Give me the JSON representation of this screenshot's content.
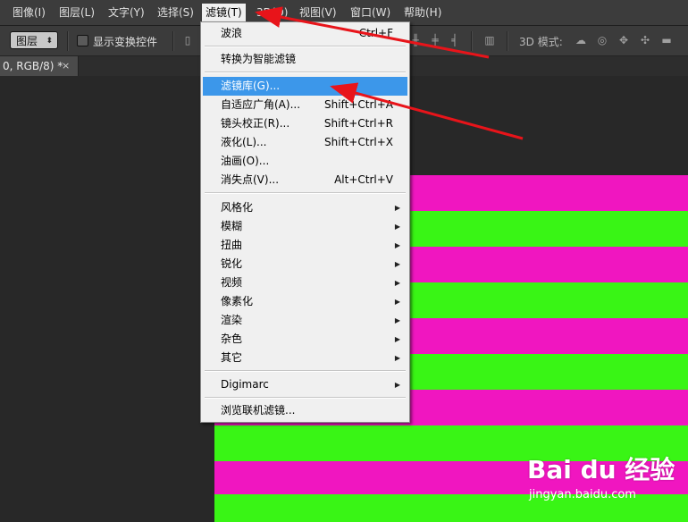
{
  "menubar": {
    "items": [
      {
        "label": "图像(I)"
      },
      {
        "label": "图层(L)"
      },
      {
        "label": "文字(Y)"
      },
      {
        "label": "选择(S)"
      },
      {
        "label": "滤镜(T)"
      },
      {
        "label": "3D(D)"
      },
      {
        "label": "视图(V)"
      },
      {
        "label": "窗口(W)"
      },
      {
        "label": "帮助(H)"
      }
    ],
    "active": "滤镜(T)"
  },
  "optionsbar": {
    "select_value": "图层",
    "checkbox_label": "显示变换控件",
    "checkbox_checked": false,
    "mode3d_label": "3D 模式:"
  },
  "document_tab": {
    "title": "0, RGB/8) *",
    "close": "×"
  },
  "filter_menu": {
    "items": [
      {
        "label": "波浪",
        "shortcut": "Ctrl+F"
      },
      {
        "label": "转换为智能滤镜",
        "shortcut": ""
      },
      {
        "label": "滤镜库(G)...",
        "shortcut": "",
        "highlighted": true
      },
      {
        "label": "自适应广角(A)...",
        "shortcut": "Shift+Ctrl+A"
      },
      {
        "label": "镜头校正(R)...",
        "shortcut": "Shift+Ctrl+R"
      },
      {
        "label": "液化(L)...",
        "shortcut": "Shift+Ctrl+X"
      },
      {
        "label": "油画(O)...",
        "shortcut": ""
      },
      {
        "label": "消失点(V)...",
        "shortcut": "Alt+Ctrl+V"
      },
      {
        "label": "风格化",
        "submenu": true
      },
      {
        "label": "模糊",
        "submenu": true
      },
      {
        "label": "扭曲",
        "submenu": true
      },
      {
        "label": "锐化",
        "submenu": true
      },
      {
        "label": "视频",
        "submenu": true
      },
      {
        "label": "像素化",
        "submenu": true
      },
      {
        "label": "渲染",
        "submenu": true
      },
      {
        "label": "杂色",
        "submenu": true
      },
      {
        "label": "其它",
        "submenu": true
      },
      {
        "label": "Digimarc",
        "submenu": true
      },
      {
        "label": "浏览联机滤镜..."
      }
    ]
  },
  "canvas": {
    "stripe_colors": [
      "#f016c0",
      "#39f515"
    ]
  },
  "annotation_color": "#e8141a",
  "watermark": {
    "logo": "Bai du 经验",
    "url": "jingyan.baidu.com"
  }
}
